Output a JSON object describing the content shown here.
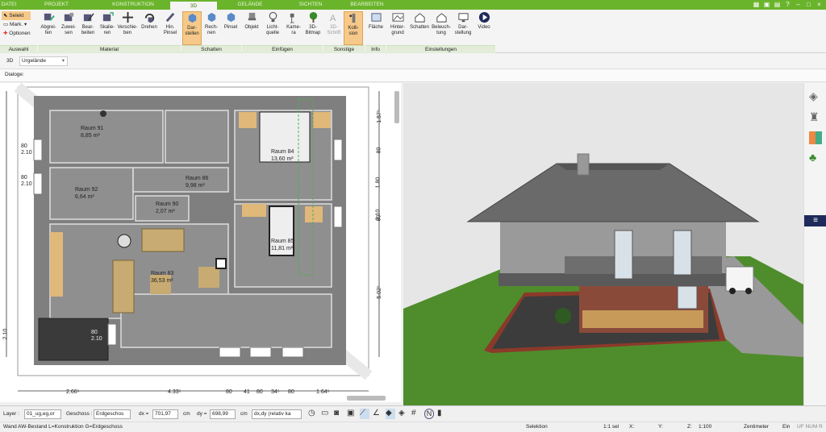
{
  "tabs": [
    "DATEI",
    "PROJEKT",
    "KONSTRUKTION",
    "3D",
    "GELÄNDE",
    "SICHTEN",
    "BEARBEITEN"
  ],
  "selection": {
    "selekt": "Selekt",
    "mark": "Mark.",
    "optionen": "Optionen"
  },
  "ribbon": {
    "material": [
      "Abgrei-\nfen",
      "Zuwei-\nsen",
      "Bear-\nbeiten",
      "Skalie-\nren",
      "Verschie-\nben",
      "Drehen",
      "Hin.\nPinsel"
    ],
    "schatten": [
      "Dar-\nstellen",
      "Rech-\nnen",
      "Pinsel"
    ],
    "einfuegen": [
      "Objekt",
      "Licht-\nquelle",
      "Kame-\nra",
      "3D-\nBitmap"
    ],
    "sonstige": [
      "3D-\nSchrift",
      "Kolli-\nsion"
    ],
    "info": [
      "Fläche"
    ],
    "einstellungen": [
      "Hinter-\ngrund",
      "Schatten",
      "Beleuch-\ntung",
      "Dar-\nstellung",
      "Video"
    ]
  },
  "groups": {
    "auswahl": "Auswahl",
    "material": "Material",
    "schatten": "Schatten",
    "einfuegen": "Einfügen",
    "sonstige": "Sonstige",
    "info": "Info",
    "einstellungen": "Einstellungen"
  },
  "view": {
    "mode": "3D",
    "terrain": "Urgelände",
    "dialoge": "Dialoge:"
  },
  "rooms": [
    {
      "name": "Raum 91",
      "area": "8,85 m²"
    },
    {
      "name": "Raum 92",
      "area": "6,64 m²"
    },
    {
      "name": "Raum 86",
      "area": "9,98 m²"
    },
    {
      "name": "Raum 90",
      "area": "2,07 m²"
    },
    {
      "name": "Raum 84",
      "area": "13,60 m²"
    },
    {
      "name": "Raum 85",
      "area": "11,81 m²"
    },
    {
      "name": "Raum 83",
      "area": "36,53 m²"
    }
  ],
  "dims_bottom": [
    "2.66⁵",
    "4.33⁵",
    "80",
    "41",
    "80",
    "34⁵",
    "80",
    "1.64⁵"
  ],
  "dims_right": [
    "1.57⁵",
    "80",
    "1.80",
    "80",
    "2.10",
    "5.02⁵",
    "2.10"
  ],
  "dims_left": [
    "80",
    "2.10",
    "80",
    "2.10",
    "80",
    "2.10"
  ],
  "status": {
    "layer_label": "Layer :",
    "layer_value": "01_ug,eg,or",
    "geschoss_label": "Geschoss :",
    "geschoss_value": "Erdgeschos",
    "dx_label": "dx =",
    "dx_value": "701,97",
    "unit1": "cm",
    "dy_label": "dy =",
    "dy_value": "698,99",
    "unit2": "cm",
    "rel": "dx,dy (relativ ka"
  },
  "info": {
    "layer_text": "Wand AW-Bestand L=Konstruktion G=Erdgeschoss",
    "mode": "Selektion",
    "sel": "1:1 sel",
    "x": "X:",
    "y": "Y:",
    "z": "Z:",
    "scale": "1:100",
    "unit": "Zentimeter",
    "ein": "Ein",
    "uf": "UF NUM R"
  },
  "colors": {
    "accent": "#6ab42c",
    "highlight": "#f6c98a",
    "floor": "#8c8c8c",
    "grass": "#4f8d2c"
  }
}
